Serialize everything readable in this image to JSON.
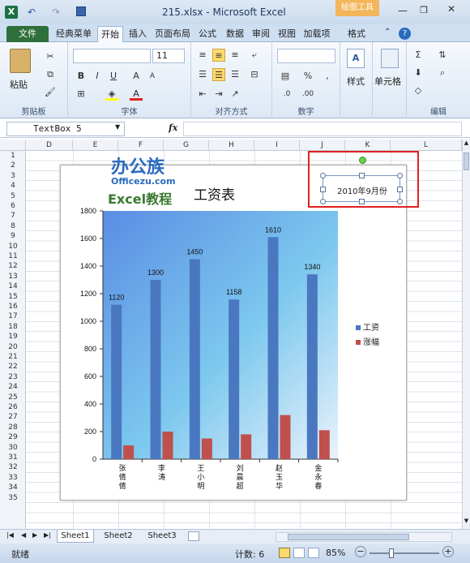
{
  "window": {
    "title": "215.xlsx - Microsoft Excel",
    "contextual_tab": "绘图工具"
  },
  "tabs": [
    "文件",
    "经典菜单",
    "开始",
    "插入",
    "页面布局",
    "公式",
    "数据",
    "审阅",
    "视图",
    "加载项",
    "格式"
  ],
  "ribbon": {
    "paste_label": "粘贴",
    "group_labels": [
      "剪贴板",
      "字体",
      "对齐方式",
      "数字",
      "编辑"
    ],
    "font_size": "11",
    "style_label": "样式",
    "cell_label": "单元格"
  },
  "formula_bar": {
    "name_box": "TextBox 5",
    "fx": "fx",
    "value": ""
  },
  "columns": [
    "D",
    "E",
    "F",
    "G",
    "H",
    "I",
    "J",
    "K",
    "L"
  ],
  "rows": [
    "1",
    "2",
    "3",
    "4",
    "5",
    "6",
    "7",
    "8",
    "9",
    "10",
    "11",
    "12",
    "13",
    "14",
    "15",
    "16",
    "17",
    "18",
    "19",
    "20",
    "21",
    "22",
    "23",
    "24",
    "25",
    "26",
    "27",
    "28",
    "29",
    "30",
    "31",
    "32",
    "33",
    "34",
    "35"
  ],
  "watermark": {
    "cn": "办公族",
    "url": "Officezu.com",
    "course": "Excel教程"
  },
  "textbox": {
    "text": "2010年9月份"
  },
  "chart_data": {
    "type": "bar",
    "title": "工资表",
    "categories": [
      "张倩倩",
      "李涛",
      "王小明",
      "刘晨超",
      "赵玉华",
      "金永春"
    ],
    "series": [
      {
        "name": "工资",
        "values": [
          1120,
          1300,
          1450,
          1158,
          1610,
          1340
        ],
        "color": "#4a78c0"
      },
      {
        "name": "涨幅",
        "values": [
          100,
          200,
          150,
          180,
          320,
          210
        ],
        "color": "#c0504d"
      }
    ],
    "data_labels": [
      "1120",
      "1300",
      "1450",
      "1158",
      "1610",
      "1340"
    ],
    "ylim": [
      0,
      1800
    ],
    "yticks": [
      "0",
      "200",
      "400",
      "600",
      "800",
      "1000",
      "1200",
      "1400",
      "1600",
      "1800"
    ],
    "legend": "right",
    "grid": false
  },
  "sheets": [
    "Sheet1",
    "Sheet2",
    "Sheet3"
  ],
  "status": {
    "ready": "就绪",
    "count": "计数: 6",
    "zoom": "85%"
  }
}
